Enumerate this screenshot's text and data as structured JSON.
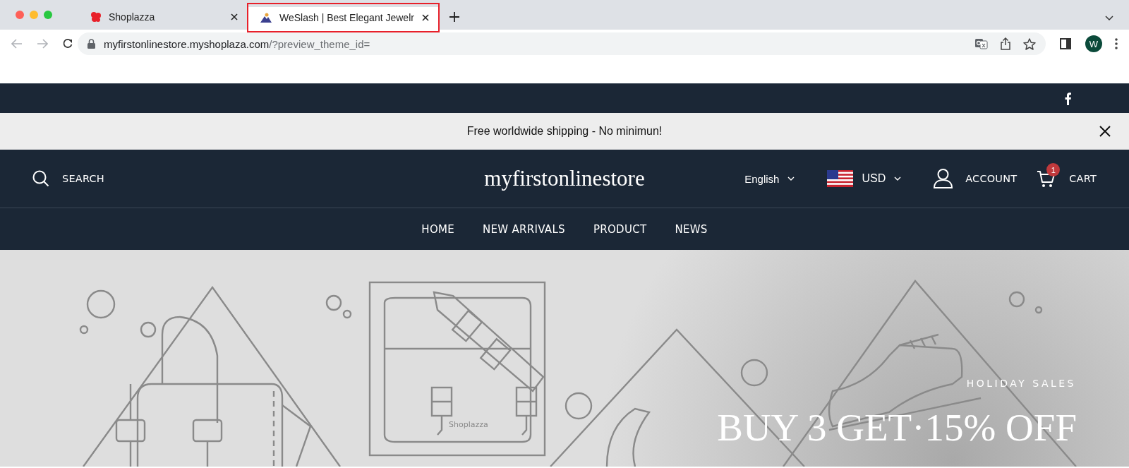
{
  "browser": {
    "tabs": [
      {
        "title": "Shoplazza",
        "selected": false,
        "highlighted": false
      },
      {
        "title": "WeSlash | Best Elegant Jewelr",
        "selected": true,
        "highlighted": true
      }
    ],
    "url_host": "myfirstonlinestore.myshoplaza.com",
    "url_path": "/?preview_theme_id=",
    "profile_initial": "W"
  },
  "announcement": {
    "text": "Free worldwide shipping - No minimun!"
  },
  "header": {
    "search_label": "SEARCH",
    "store_name": "myfirstonlinestore",
    "language": "English",
    "currency": "USD",
    "account_label": "ACCOUNT",
    "cart_label": "CART",
    "cart_count": "1"
  },
  "nav": [
    {
      "label": "HOME"
    },
    {
      "label": "NEW ARRIVALS"
    },
    {
      "label": "PRODUCT"
    },
    {
      "label": "NEWS"
    }
  ],
  "hero": {
    "bag_label": "Shoplazza",
    "eyebrow": "HOLIDAY SALES",
    "headline": "BUY 3 GET·15% OFF"
  }
}
